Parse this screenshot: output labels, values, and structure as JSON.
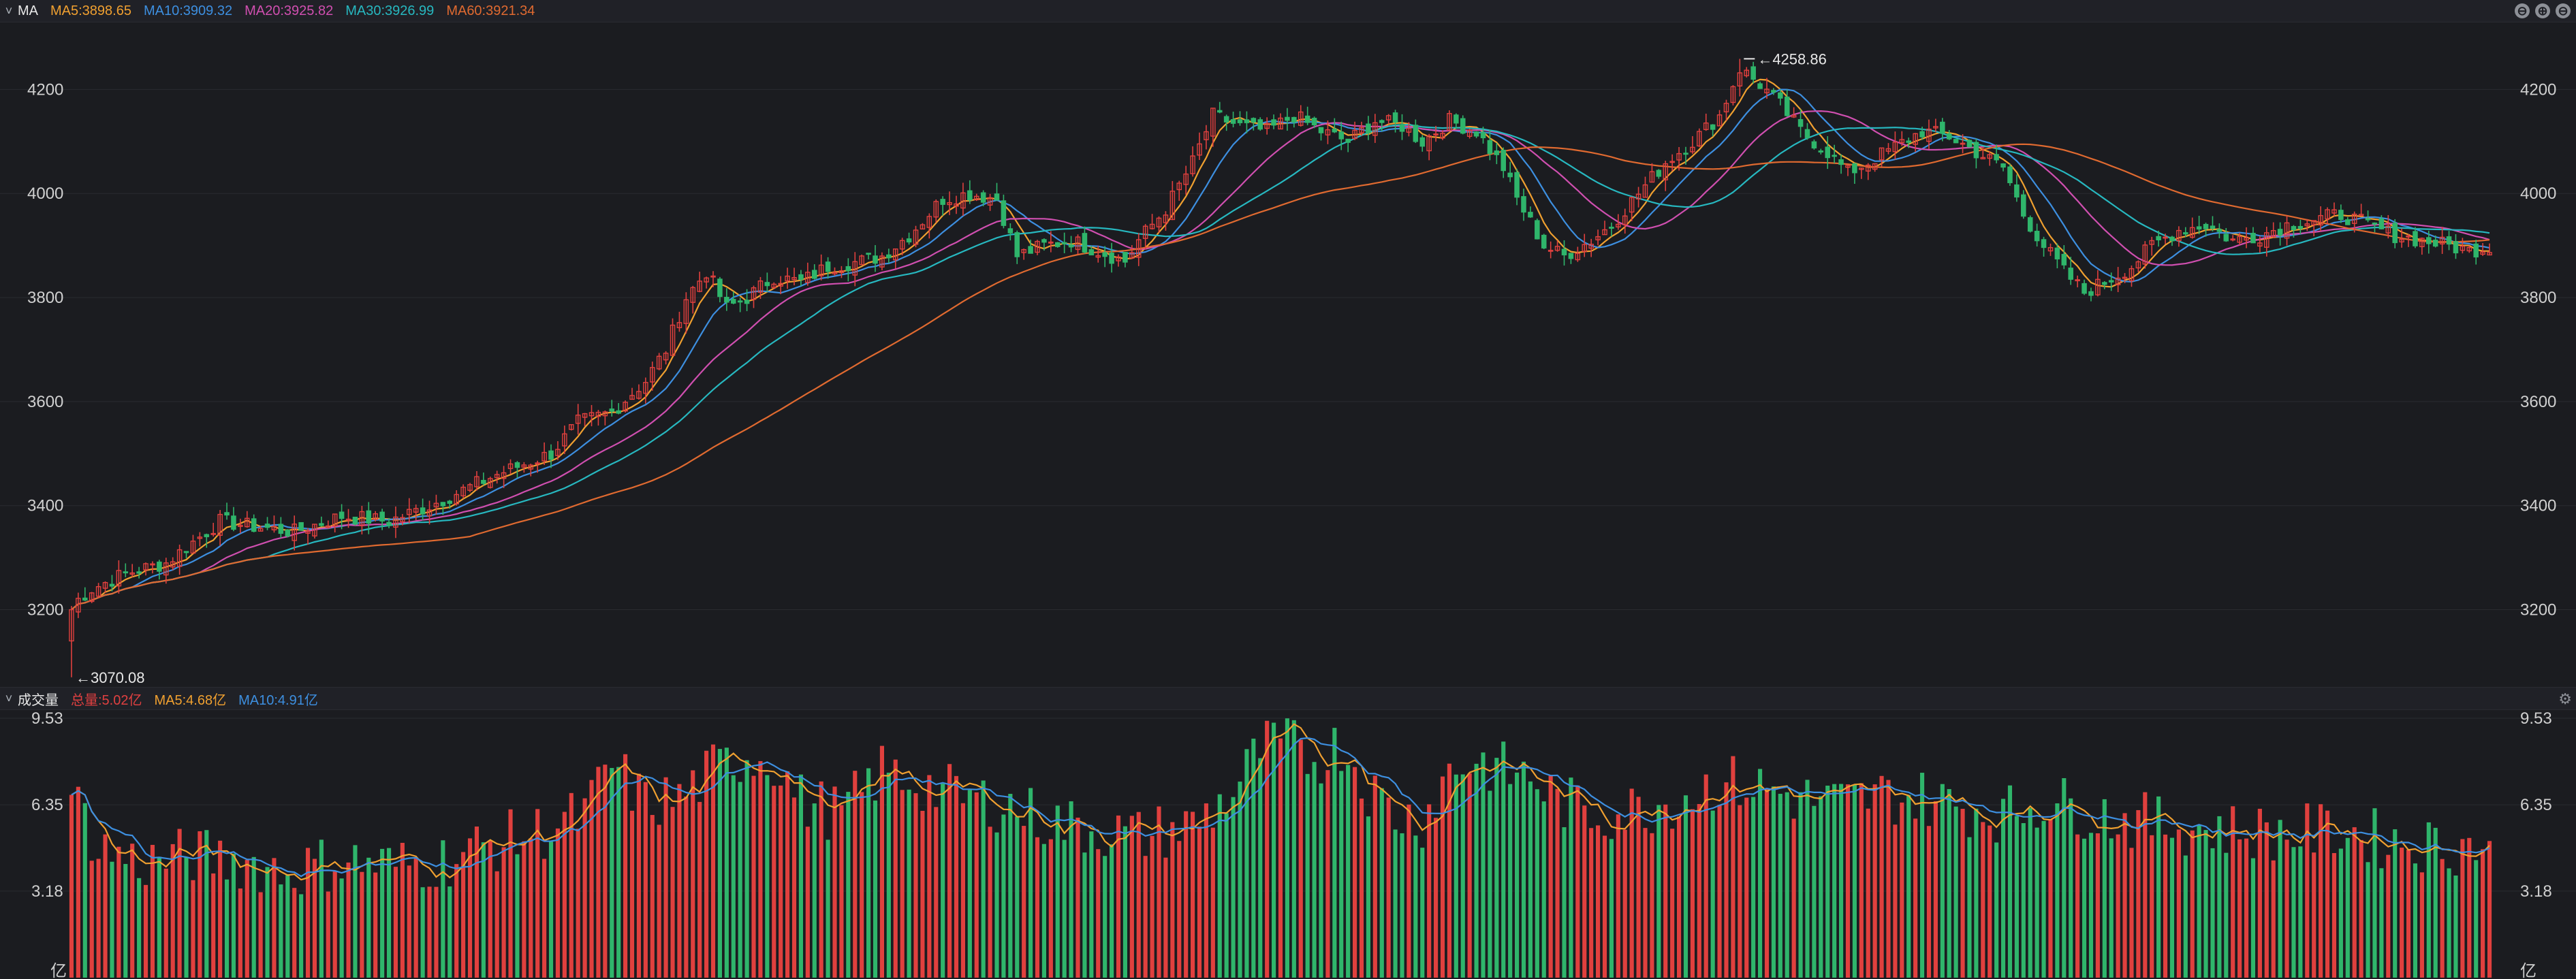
{
  "main_panel": {
    "name": "MA",
    "legend": [
      {
        "label": "MA5:3898.65",
        "color": "#f0a030"
      },
      {
        "label": "MA10:3909.32",
        "color": "#3d8fe0"
      },
      {
        "label": "MA20:3925.82",
        "color": "#d04fb0"
      },
      {
        "label": "MA30:3926.99",
        "color": "#27b8c0"
      },
      {
        "label": "MA60:3921.34",
        "color": "#e06a30"
      }
    ]
  },
  "volume_panel": {
    "name": "成交量",
    "legend": [
      {
        "label": "总量:5.02亿",
        "color": "#e04040"
      },
      {
        "label": "MA5:4.68亿",
        "color": "#f0a030"
      },
      {
        "label": "MA10:4.91亿",
        "color": "#3d8fe0"
      }
    ]
  },
  "window_controls": {
    "minimize": "⊖",
    "add": "⊕",
    "collapse": "⊖",
    "settings_icon": "gear-icon"
  },
  "colors": {
    "up": "#e0403e",
    "down": "#2fb56b",
    "grid": "#2a2b30",
    "background": "#1b1c20"
  },
  "chart_data": [
    {
      "type": "candlestick",
      "title": "MA",
      "x_count": 240,
      "ylim": [
        3070,
        4260
      ],
      "y_ticks": [
        "3200",
        "3400",
        "3600",
        "3800",
        "4000",
        "4200"
      ],
      "annotations": [
        {
          "label": "4258.86",
          "value": 4258.86,
          "kind": "max"
        },
        {
          "label": "3070.08",
          "value": 3070.08,
          "kind": "min"
        }
      ],
      "close_anchors": [
        [
          0,
          3210
        ],
        [
          3,
          3240
        ],
        [
          8,
          3270
        ],
        [
          14,
          3290
        ],
        [
          18,
          3330
        ],
        [
          22,
          3370
        ],
        [
          27,
          3360
        ],
        [
          33,
          3350
        ],
        [
          40,
          3380
        ],
        [
          47,
          3370
        ],
        [
          53,
          3400
        ],
        [
          58,
          3430
        ],
        [
          63,
          3460
        ],
        [
          67,
          3480
        ],
        [
          71,
          3500
        ],
        [
          75,
          3560
        ],
        [
          80,
          3580
        ],
        [
          85,
          3640
        ],
        [
          88,
          3700
        ],
        [
          91,
          3800
        ],
        [
          94,
          3850
        ],
        [
          97,
          3780
        ],
        [
          100,
          3800
        ],
        [
          104,
          3840
        ],
        [
          108,
          3830
        ],
        [
          112,
          3860
        ],
        [
          117,
          3870
        ],
        [
          120,
          3880
        ],
        [
          124,
          3920
        ],
        [
          129,
          3990
        ],
        [
          133,
          4000
        ],
        [
          137,
          3990
        ],
        [
          140,
          3880
        ],
        [
          144,
          3900
        ],
        [
          148,
          3910
        ],
        [
          152,
          3890
        ],
        [
          156,
          3870
        ],
        [
          158,
          3910
        ],
        [
          162,
          3970
        ],
        [
          166,
          4060
        ],
        [
          169,
          4150
        ],
        [
          173,
          4130
        ],
        [
          177,
          4120
        ],
        [
          181,
          4150
        ],
        [
          185,
          4120
        ],
        [
          189,
          4100
        ],
        [
          193,
          4140
        ],
        [
          197,
          4130
        ],
        [
          200,
          4100
        ],
        [
          204,
          4140
        ],
        [
          208,
          4120
        ],
        [
          212,
          4050
        ],
        [
          214,
          3990
        ],
        [
          218,
          3900
        ],
        [
          221,
          3880
        ],
        [
          225,
          3910
        ],
        [
          228,
          3940
        ],
        [
          232,
          4000
        ],
        [
          236,
          4060
        ],
        [
          240,
          4100
        ],
        [
          244,
          4150
        ],
        [
          247,
          4240
        ],
        [
          250,
          4210
        ],
        [
          253,
          4170
        ],
        [
          256,
          4120
        ],
        [
          260,
          4080
        ],
        [
          263,
          4040
        ],
        [
          266,
          4060
        ],
        [
          270,
          4090
        ],
        [
          274,
          4120
        ],
        [
          278,
          4110
        ],
        [
          282,
          4080
        ],
        [
          286,
          4050
        ],
        [
          289,
          3960
        ],
        [
          292,
          3900
        ],
        [
          295,
          3850
        ],
        [
          298,
          3810
        ],
        [
          301,
          3830
        ],
        [
          305,
          3860
        ],
        [
          308,
          3900
        ],
        [
          312,
          3930
        ],
        [
          316,
          3940
        ],
        [
          320,
          3910
        ],
        [
          324,
          3920
        ],
        [
          328,
          3940
        ],
        [
          332,
          3950
        ],
        [
          336,
          3960
        ],
        [
          340,
          3940
        ],
        [
          344,
          3920
        ],
        [
          348,
          3910
        ],
        [
          352,
          3900
        ],
        [
          355,
          3890
        ],
        [
          358,
          3898
        ]
      ],
      "y_unit": "",
      "series": [
        {
          "name": "MA5",
          "period": 5
        },
        {
          "name": "MA10",
          "period": 10
        },
        {
          "name": "MA20",
          "period": 20
        },
        {
          "name": "MA30",
          "period": 30
        },
        {
          "name": "MA60",
          "period": 60
        }
      ]
    },
    {
      "type": "bar",
      "title": "成交量",
      "ylim": [
        0,
        9.53
      ],
      "y_ticks": [
        "9.53",
        "6.35",
        "3.18"
      ],
      "y_unit": "亿",
      "volume_anchors": [
        [
          0,
          6.8
        ],
        [
          4,
          4.8
        ],
        [
          10,
          4.2
        ],
        [
          18,
          4.5
        ],
        [
          25,
          4.3
        ],
        [
          32,
          3.9
        ],
        [
          40,
          4.3
        ],
        [
          48,
          4.1
        ],
        [
          55,
          4.3
        ],
        [
          62,
          4.9
        ],
        [
          70,
          5.4
        ],
        [
          76,
          6.0
        ],
        [
          80,
          7.8
        ],
        [
          85,
          6.4
        ],
        [
          90,
          6.6
        ],
        [
          95,
          7.6
        ],
        [
          100,
          8.2
        ],
        [
          104,
          8.0
        ],
        [
          108,
          6.5
        ],
        [
          114,
          6.0
        ],
        [
          120,
          7.6
        ],
        [
          126,
          7.1
        ],
        [
          132,
          6.6
        ],
        [
          138,
          6.4
        ],
        [
          144,
          5.8
        ],
        [
          150,
          5.5
        ],
        [
          158,
          5.2
        ],
        [
          166,
          5.6
        ],
        [
          172,
          6.8
        ],
        [
          176,
          8.4
        ],
        [
          180,
          8.6
        ],
        [
          184,
          8.0
        ],
        [
          188,
          8.6
        ],
        [
          192,
          7.0
        ],
        [
          196,
          6.0
        ],
        [
          200,
          5.8
        ],
        [
          204,
          7.6
        ],
        [
          208,
          8.0
        ],
        [
          212,
          7.6
        ],
        [
          216,
          7.4
        ],
        [
          220,
          6.5
        ],
        [
          226,
          6.0
        ],
        [
          232,
          6.2
        ],
        [
          238,
          6.6
        ],
        [
          244,
          7.2
        ],
        [
          250,
          7.0
        ],
        [
          256,
          6.6
        ],
        [
          262,
          6.4
        ],
        [
          268,
          6.7
        ],
        [
          274,
          6.6
        ],
        [
          280,
          6.3
        ],
        [
          286,
          6.0
        ],
        [
          292,
          6.5
        ],
        [
          298,
          6.2
        ],
        [
          304,
          5.8
        ],
        [
          312,
          5.6
        ],
        [
          320,
          5.4
        ],
        [
          328,
          5.3
        ],
        [
          336,
          5.4
        ],
        [
          344,
          5.0
        ],
        [
          352,
          4.8
        ],
        [
          358,
          5.02
        ]
      ],
      "series": [
        {
          "name": "MA5",
          "period": 5
        },
        {
          "name": "MA10",
          "period": 10
        }
      ]
    }
  ]
}
